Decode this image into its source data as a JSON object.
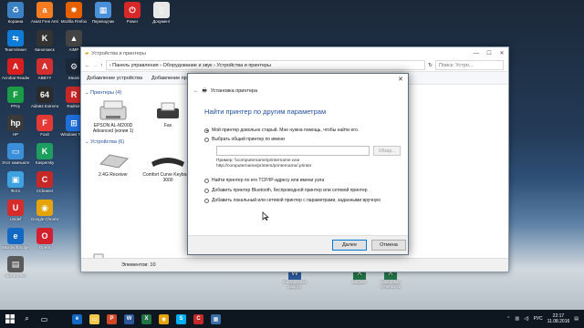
{
  "desktop": {
    "icons": [
      {
        "label": "Корзина",
        "glyph": "♻",
        "color": "#3b82c4"
      },
      {
        "label": "TeamViewer",
        "glyph": "⇆",
        "color": "#0e7bd8"
      },
      {
        "label": "Acrobat Reader DC",
        "glyph": "A",
        "color": "#d71f1f"
      },
      {
        "label": "FFtry",
        "glyph": "F",
        "color": "#1a9b46"
      },
      {
        "label": "HP",
        "glyph": "hp",
        "color": "#3a3a3a"
      },
      {
        "label": "Этот компьютер",
        "glyph": "▭",
        "color": "#3b8ed8"
      },
      {
        "label": "Фото",
        "glyph": "▣",
        "color": "#3da3e0"
      },
      {
        "label": "Unidef",
        "glyph": "U",
        "color": "#d72c2c"
      },
      {
        "label": "Microsoft Edge",
        "glyph": "e",
        "color": "#1269c4"
      },
      {
        "label": "Диспетчер",
        "glyph": "▤",
        "color": "#5a5a5a"
      },
      {
        "label": "Avast Free Antivirus",
        "glyph": "a",
        "color": "#f47b20"
      },
      {
        "label": "Кинопоиск",
        "glyph": "K",
        "color": "#333333"
      },
      {
        "label": "ABBYY",
        "glyph": "A",
        "color": "#d32f2f"
      },
      {
        "label": "Aida64 Extreme",
        "glyph": "64",
        "color": "#2b2b2b"
      },
      {
        "label": "Foxit",
        "glyph": "F",
        "color": "#e53935"
      },
      {
        "label": "Kaspersky",
        "glyph": "K",
        "color": "#1b9e5e"
      },
      {
        "label": "CCleaner",
        "glyph": "C",
        "color": "#c62828"
      },
      {
        "label": "Google Chrome",
        "glyph": "◉",
        "color": "#e5a50a"
      },
      {
        "label": "Opera",
        "glyph": "O",
        "color": "#d3202f"
      },
      {
        "label": "Mozilla Firefox",
        "glyph": "✹",
        "color": "#e66000"
      },
      {
        "label": "AIMP",
        "glyph": "▲",
        "color": "#444444"
      },
      {
        "label": "Steam",
        "glyph": "⚙",
        "color": "#1b2838"
      },
      {
        "label": "Radmin",
        "glyph": "R",
        "color": "#c62828"
      },
      {
        "label": "Windows Tools",
        "glyph": "⊞",
        "color": "#1e6fd9"
      },
      {
        "label": "Переводчик",
        "glyph": "▦",
        "color": "#4a90d9"
      },
      {
        "label": "Power",
        "glyph": "⏻",
        "color": "#d62828"
      },
      {
        "label": "Документ",
        "glyph": "▯",
        "color": "#e8e8e8"
      }
    ],
    "bottom_icons": [
      {
        "label": "Контрольная работа",
        "glyph": "W",
        "color": "#2b579a"
      },
      {
        "label": "Бюджет",
        "glyph": "X",
        "color": "#217346"
      },
      {
        "label": "Налоговая отчетность",
        "glyph": "X",
        "color": "#217346"
      }
    ]
  },
  "explorer": {
    "title": "Устройства и принтеры",
    "controls": [
      "—",
      "☐",
      "✕"
    ],
    "breadcrumb": "› Панель управления  ›  Оборудование и звук  ›  Устройства и принтеры",
    "search_placeholder": "Поиск: Устро...",
    "toolbar": {
      "add_device": "Добавление устройства",
      "add_printer": "Добавление принтера"
    },
    "printers_group": "Принтеры (4)",
    "printers": [
      {
        "name": "EPSON AL-M200D Advanced (копия 1)"
      },
      {
        "name": "Fax"
      }
    ],
    "devices_group": "Устройства (6)",
    "devices": [
      {
        "name": "2.4G Receiver"
      },
      {
        "name": "Comfort Curve Keyboard 3000"
      }
    ],
    "status": "Элементов: 10"
  },
  "dialog": {
    "title": "Установка принтера",
    "heading": "Найти принтер по другим параметрам",
    "options": [
      "Мой принтер довольно старый. Мне нужна помощь, чтобы найти его.",
      "Выбрать общий принтер по имени",
      "Найти принтер по его TCP/IP-адресу или имени узла",
      "Добавить принтер Bluetooth, беспроводной принтер или сетевой принтер",
      "Добавить локальный или сетевой принтер с параметрами, заданными вручную"
    ],
    "selected_index": 0,
    "browse_label": "Обзор...",
    "example": "Пример: \\\\computername\\printername или\nhttp://computername/printers/printername/.printer",
    "next_label": "Далее",
    "cancel_label": "Отмена",
    "close": "✕"
  },
  "taskbar": {
    "language": "РУС",
    "time": "22:17",
    "date": "11.08.2016",
    "apps": [
      {
        "glyph": "e",
        "color": "#1269c4"
      },
      {
        "glyph": "▭",
        "color": "#f2c94c"
      },
      {
        "glyph": "P",
        "color": "#d24726"
      },
      {
        "glyph": "W",
        "color": "#2b579a"
      },
      {
        "glyph": "X",
        "color": "#217346"
      },
      {
        "glyph": "◉",
        "color": "#e5a50a"
      },
      {
        "glyph": "S",
        "color": "#00aff0"
      },
      {
        "glyph": "C",
        "color": "#c62828"
      },
      {
        "glyph": "▦",
        "color": "#3a6ea5"
      }
    ]
  }
}
